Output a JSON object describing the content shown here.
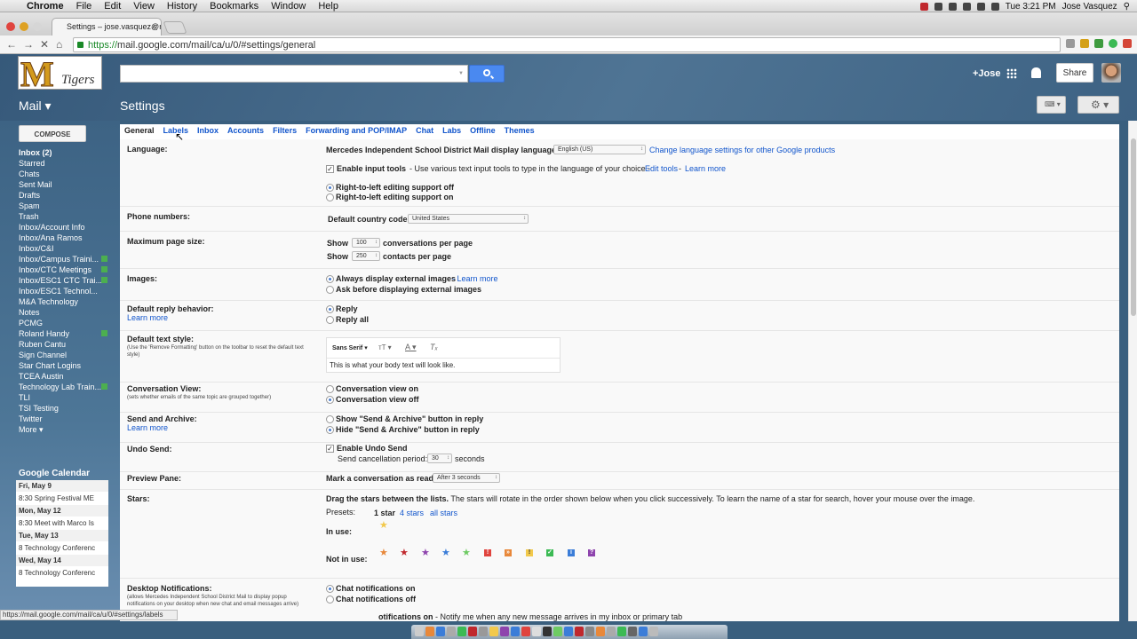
{
  "mac_menu": {
    "app": "Chrome",
    "items": [
      "File",
      "Edit",
      "View",
      "History",
      "Bookmarks",
      "Window",
      "Help"
    ],
    "clock": "Tue 3:21 PM",
    "user": "Jose Vasquez"
  },
  "browser": {
    "tab_title": "Settings – jose.vasquez@mi",
    "url_scheme": "https://",
    "url_rest": "mail.google.com/mail/ca/u/0/#settings/general"
  },
  "header": {
    "logo_letter": "M",
    "logo_text": "Tigers",
    "user_link": "+Jose",
    "share_label": "Share",
    "mail_label": "Mail ▾",
    "page_title": "Settings"
  },
  "sidebar": {
    "compose_label": "COMPOSE",
    "items": [
      {
        "label": "Inbox (2)",
        "bold": true,
        "tag": false
      },
      {
        "label": "Starred",
        "bold": false,
        "tag": false
      },
      {
        "label": "Chats",
        "bold": false,
        "tag": false
      },
      {
        "label": "Sent Mail",
        "bold": false,
        "tag": false
      },
      {
        "label": "Drafts",
        "bold": false,
        "tag": false
      },
      {
        "label": "Spam",
        "bold": false,
        "tag": false
      },
      {
        "label": "Trash",
        "bold": false,
        "tag": false
      },
      {
        "label": "Inbox/Account Info",
        "bold": false,
        "tag": false
      },
      {
        "label": "Inbox/Ana Ramos",
        "bold": false,
        "tag": false
      },
      {
        "label": "Inbox/C&I",
        "bold": false,
        "tag": false
      },
      {
        "label": "Inbox/Campus Traini...",
        "bold": false,
        "tag": true
      },
      {
        "label": "Inbox/CTC Meetings",
        "bold": false,
        "tag": true
      },
      {
        "label": "Inbox/ESC1 CTC Trai...",
        "bold": false,
        "tag": true
      },
      {
        "label": "Inbox/ESC1 Technol...",
        "bold": false,
        "tag": false
      },
      {
        "label": "M&A Technology",
        "bold": false,
        "tag": false
      },
      {
        "label": "Notes",
        "bold": false,
        "tag": false
      },
      {
        "label": "PCMG",
        "bold": false,
        "tag": false
      },
      {
        "label": "Roland Handy",
        "bold": false,
        "tag": true
      },
      {
        "label": "Ruben Cantu",
        "bold": false,
        "tag": false
      },
      {
        "label": "Sign Channel",
        "bold": false,
        "tag": false
      },
      {
        "label": "Star Chart Logins",
        "bold": false,
        "tag": false
      },
      {
        "label": "TCEA Austin",
        "bold": false,
        "tag": false
      },
      {
        "label": "Technology Lab Train...",
        "bold": false,
        "tag": true
      },
      {
        "label": "TLI",
        "bold": false,
        "tag": false
      },
      {
        "label": "TSI Testing",
        "bold": false,
        "tag": false
      },
      {
        "label": "Twitter",
        "bold": false,
        "tag": false
      },
      {
        "label": "More ▾",
        "bold": false,
        "tag": false
      }
    ],
    "calendar": {
      "title": "Google Calendar",
      "entries": [
        {
          "day": "Fri, May 9",
          "event": "8:30 Spring Festival ME"
        },
        {
          "day": "Mon, May 12",
          "event": "8:30 Meet with Marco Is"
        },
        {
          "day": "Tue, May 13",
          "event": "8 Technology Conferenc"
        },
        {
          "day": "Wed, May 14",
          "event": "8 Technology Conferenc"
        }
      ]
    }
  },
  "tabs": [
    "General",
    "Labels",
    "Inbox",
    "Accounts",
    "Filters",
    "Forwarding and POP/IMAP",
    "Chat",
    "Labs",
    "Offline",
    "Themes"
  ],
  "settings": {
    "language": {
      "label": "Language:",
      "text": "Mercedes Independent School District Mail display language:",
      "value": "English (US)",
      "link": "Change language settings for other Google products",
      "input_tools": "Enable input tools",
      "input_tools_desc": "- Use various text input tools to type in the language of your choice -",
      "edit_tools": "Edit tools",
      "dash": "-",
      "learn_more": "Learn more",
      "rtl_off": "Right-to-left editing support off",
      "rtl_on": "Right-to-left editing support on"
    },
    "phone": {
      "label": "Phone numbers:",
      "text": "Default country code:",
      "value": "United States"
    },
    "page_size": {
      "label": "Maximum page size:",
      "show": "Show",
      "conv_value": "100",
      "conv_text": "conversations per page",
      "contacts_value": "250",
      "contacts_text": "contacts per page"
    },
    "images": {
      "label": "Images:",
      "always": "Always display external images",
      "learn_more": "- Learn more",
      "ask": "Ask before displaying external images"
    },
    "reply": {
      "label": "Default reply behavior:",
      "learn_more": "Learn more",
      "reply": "Reply",
      "reply_all": "Reply all"
    },
    "text_style": {
      "label": "Default text style:",
      "note": "(Use the 'Remove Formatting' button on the toolbar to reset the default text style)",
      "font": "Sans Serif",
      "sample": "This is what your body text will look like."
    },
    "conversation": {
      "label": "Conversation View:",
      "note": "(sets whether emails of the same topic are grouped together)",
      "on": "Conversation view on",
      "off": "Conversation view off"
    },
    "send_archive": {
      "label": "Send and Archive:",
      "learn_more": "Learn more",
      "show": "Show \"Send & Archive\" button in reply",
      "hide": "Hide \"Send & Archive\" button in reply"
    },
    "undo": {
      "label": "Undo Send:",
      "enable": "Enable Undo Send",
      "period": "Send cancellation period:",
      "value": "30",
      "unit": "seconds"
    },
    "preview": {
      "label": "Preview Pane:",
      "text": "Mark a conversation as read:",
      "value": "After 3 seconds"
    },
    "stars": {
      "label": "Stars:",
      "instr_bold": "Drag the stars between the lists.",
      "instr": "The stars will rotate in the order shown below when you click successively. To learn the name of a star for search, hover your mouse over the image.",
      "presets": "Presets:",
      "preset_1": "1 star",
      "preset_4": "4 stars",
      "preset_all": "all stars",
      "in_use": "In use:",
      "not_in_use": "Not in use:"
    },
    "desktop": {
      "label": "Desktop Notifications:",
      "note": "(allows Mercedes Independent School District Mail to display popup notifications on your desktop when new chat and email messages arrive)",
      "chat_on": "Chat notifications on",
      "chat_off": "Chat notifications off",
      "mail_on": "otifications on",
      "mail_on_desc": "- Notify me when any new message arrives in my inbox or primary tab"
    }
  },
  "status_bar": "https://mail.google.com/mail/ca/u/0/#settings/labels",
  "colors": {
    "link": "#1155cc",
    "accent": "#4a89f0",
    "tag_green": "#4caf50"
  }
}
